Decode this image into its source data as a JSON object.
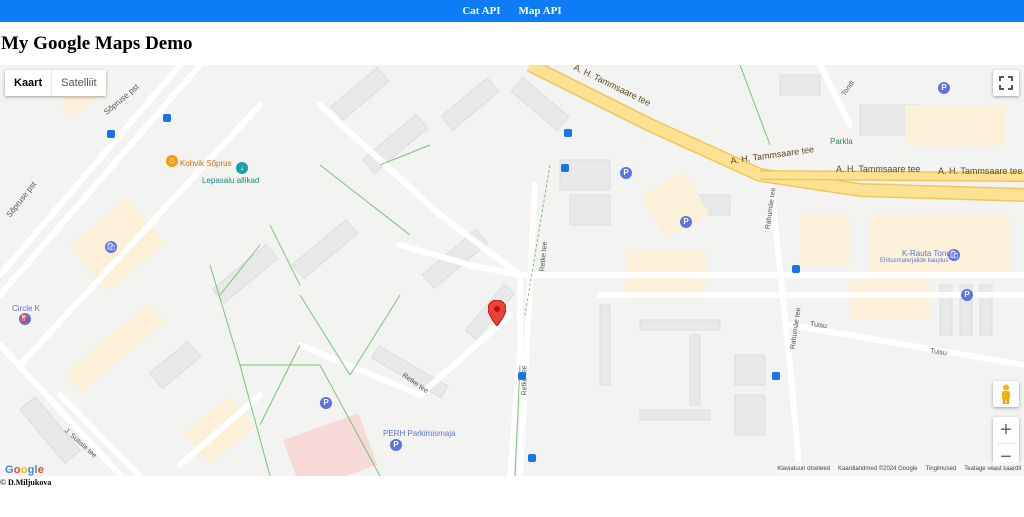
{
  "nav": {
    "items": [
      {
        "label": "Cat API"
      },
      {
        "label": "Map API"
      }
    ]
  },
  "page": {
    "title": "My Google Maps Demo"
  },
  "map": {
    "type_controls": {
      "map": "Kaart",
      "satellite": "Satelliit"
    },
    "labels": {
      "sopruse_pst": "Sõpruse pst",
      "tammsaare": "A. H. Tammsaare tee",
      "parkla": "Parkla",
      "kohvik": "Kohvik Sõprus",
      "lepasalu": "Lepasalu allikad",
      "sopruse_pst_small": "Sõpruse pst",
      "circle_k": "Circle K",
      "krauta": "K-Rauta Tondi",
      "krauta_sub": "Ehitusmaterjalide kauplus",
      "tondi": "Tondi",
      "retke": "Retke tee",
      "rahumae": "Rahumäe tee",
      "tuisu": "Tuisu",
      "perh": "PERH Parkimismaja",
      "sutiste": "J. Sütiste tee"
    },
    "logo": "Google",
    "attribution": {
      "shortcuts": "Klaviatuuri otseteed",
      "mapdata": "Kaardiandmed ©2024 Google",
      "terms": "Tingimused",
      "report": "Teatage veast kaardil"
    },
    "colors": {
      "marker": "#ea4335",
      "highway": "#fde293",
      "highway_border": "#f2c45c",
      "park_path": "#5cb85c",
      "poi_blue": "#5e72e4"
    }
  },
  "footer": {
    "text": "© D.Miljukova"
  }
}
